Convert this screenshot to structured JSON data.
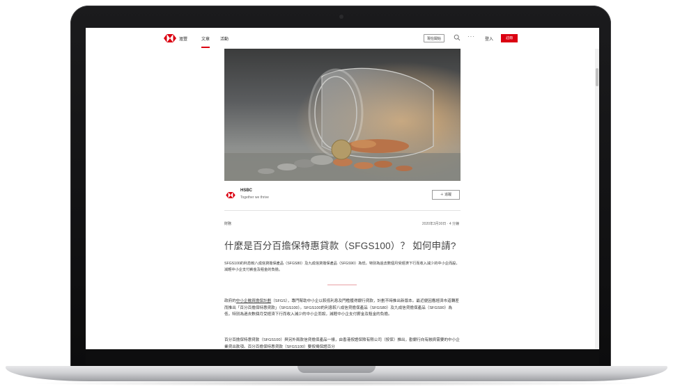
{
  "nav": {
    "brand": "滙豐",
    "tab_articles": "文章",
    "tab_events": "活動",
    "start_button": "現在開始",
    "more_icon": "···",
    "signin": "登入",
    "register": "註冊"
  },
  "author": {
    "name": "HSBC",
    "tagline": "Together we thrive",
    "follow_label": "＋ 追蹤"
  },
  "article": {
    "category": "財務",
    "date": "2020年3月30日 · 4 分鐘",
    "title": "什麼是百分百擔保特惠貸款（SFGS100）？ 如何申請?",
    "summary": "SFGS100的利息較八成信貸擔保產品（SFGS80）及九成信貸擔保產品（SFGS90）為低，特別為過去數個月受經濟下行而收入減少的中小企而設，減輕中小企支付薪金及租金的負擔。",
    "p1_link": "中小企融資擔保計劃",
    "p1_pre": "政府的",
    "p1_rest": "（SFGS），專門幫助中小企以較低利息及門檻獲得銀行貸款，計劃不時推出新版本。最近便因應經濟市道轉差而推出「百分百擔保特惠貸款」（SFGS100）。SFGS100的利息較八成信貸擔保產品（SFGS80）及九成信貸擔保產品（SFGS90）為低，特別為過去數個月受經濟下行而收入減少的中小企而設，減輕中小企支付薪金及租金的負擔。",
    "p2": "百分百擔保特惠貸款（SFGS100）與另外兩款信貸擔保產品一樣，由香港按證保險有限公司（按保）推出，勸銀行向有融資需要的中小企業貸出款項。百分百擔保特惠貸款（SFGS100）要按揭保證百分"
  },
  "colors": {
    "brand_red": "#db0011",
    "text": "#333333"
  }
}
